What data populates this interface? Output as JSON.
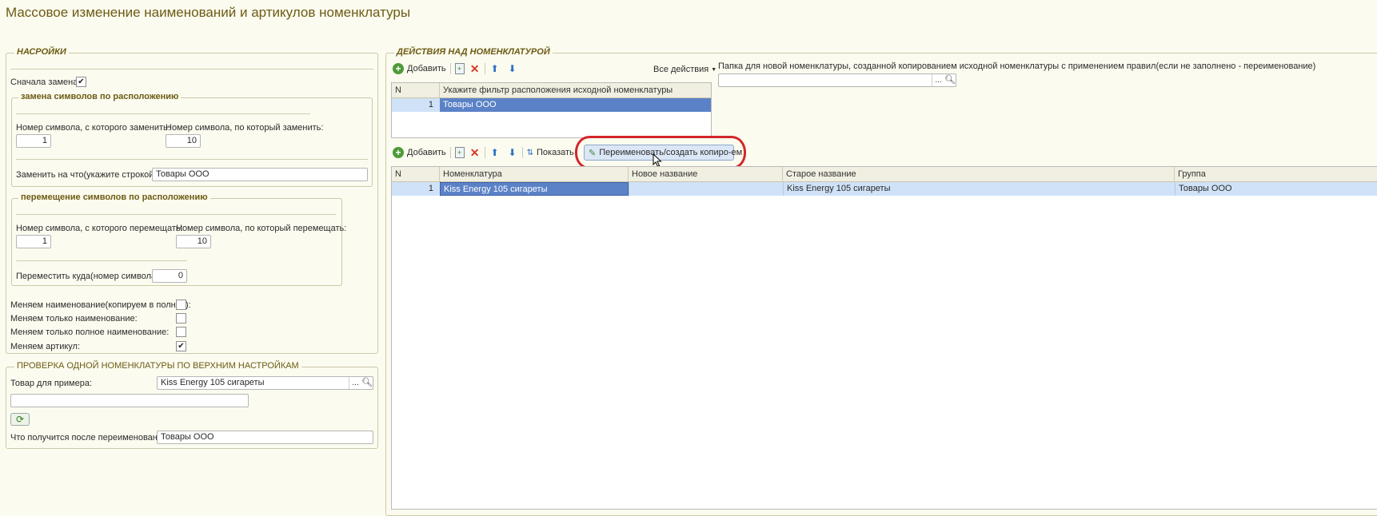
{
  "window": {
    "title": "Массовое изменение наименований и артикулов номенклатуры"
  },
  "settings": {
    "legend": "НАСРОЙКИ",
    "replace_first_label": "Сначала замена:",
    "replace_first_checked": true,
    "replace_group": {
      "legend": "замена символов по расположению",
      "from_label": "Номер символа, с которого заменить:",
      "from_value": "1",
      "to_label": "Номер символа, по который заменить:",
      "to_value": "10",
      "replace_with_label": "Заменить на что(укажите строкой):",
      "replace_with_value": "Товары ООО"
    },
    "move_group": {
      "legend": "перемещение символов по расположению",
      "from_label": "Номер символа, с которого перемещать:",
      "from_value": "1",
      "to_label": "Номер символа, по который перемещать:",
      "to_value": "10",
      "target_label": "Переместить куда(номер символа):",
      "target_value": "0"
    },
    "options": [
      {
        "label": "Меняем наименование(копируем в полное):",
        "checked": false
      },
      {
        "label": "Меняем только наименование:",
        "checked": false
      },
      {
        "label": "Меняем только полное наименование:",
        "checked": false
      },
      {
        "label": "Меняем артикул:",
        "checked": true
      }
    ]
  },
  "check": {
    "legend": "ПРОВЕРКА ОДНОЙ НОМЕНКЛАТУРЫ ПО ВЕРХНИМ НАСТРОЙКАМ",
    "sample_label": "Товар для примера:",
    "sample_value": "Kiss Energy 105 сигареты",
    "dots": "...",
    "extra_value": "",
    "result_label": "Что получится после переименования:",
    "result_value": "Товары ООО"
  },
  "actions": {
    "legend": "ДЕЙСТВИЯ НАД НОМЕНКЛАТУРОЙ",
    "toolbar1": {
      "add_label": "Добавить",
      "all_actions_label": "Все действия"
    },
    "folder_label": "Папка для новой номенклатуры, созданной копированием исходной номенклатуры с применением правил(если не заполнено - переименование)",
    "folder_value": "",
    "filter_table": {
      "headers": [
        "N",
        "Укажите фильтр расположения исходной номенклатуры"
      ],
      "rows": [
        {
          "n": "1",
          "value": "Товары ООО"
        }
      ]
    },
    "toolbar2": {
      "add_label": "Добавить",
      "show_label": "Показать",
      "rename_label": "Переименовать/создать копиро-ем"
    },
    "items_table": {
      "headers": [
        "N",
        "Номенклатура",
        "Новое название",
        "Старое название",
        "Группа"
      ],
      "rows": [
        {
          "n": "1",
          "item": "Kiss Energy 105 сигареты",
          "new_name": "",
          "old_name": "Kiss Energy 105 сигареты",
          "group": "Товары ООО"
        }
      ]
    }
  },
  "colors": {
    "background": "#fbfbef",
    "title": "#6d5b14",
    "highlight_row": "#cfe2f7",
    "selected_cell": "#5b82c7",
    "annotation": "#d4262a"
  }
}
